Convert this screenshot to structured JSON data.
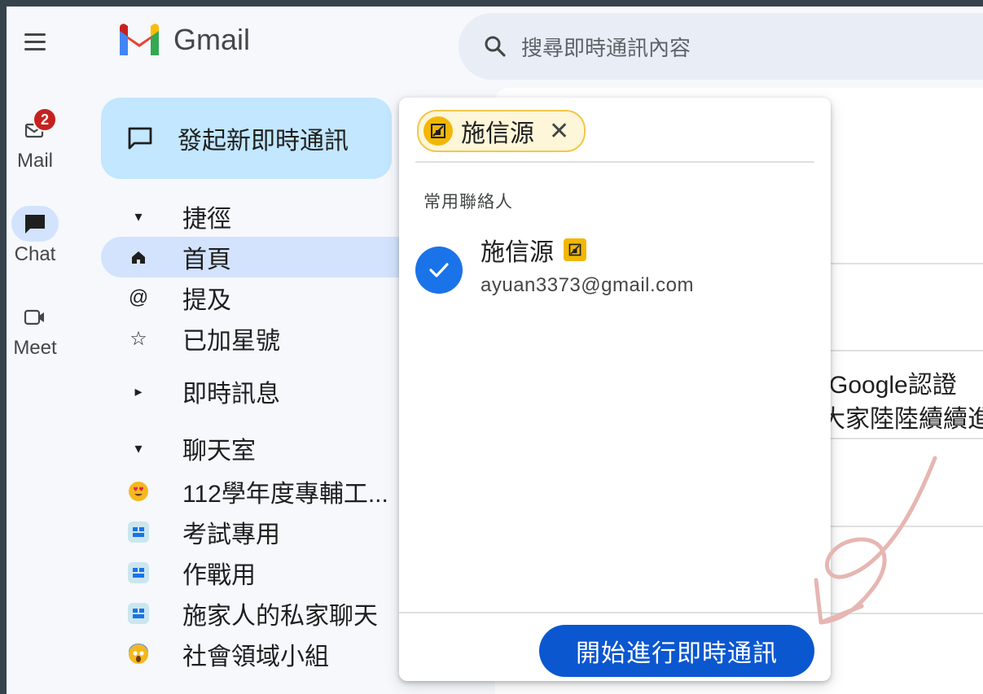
{
  "window": {
    "app_name": "Gmail"
  },
  "search": {
    "placeholder": "搜尋即時通訊內容"
  },
  "rail": {
    "items": [
      {
        "label": "Mail",
        "badge": "2",
        "icon": "mail-icon"
      },
      {
        "label": "Chat",
        "icon": "chat-icon"
      },
      {
        "label": "Meet",
        "icon": "video-icon"
      }
    ]
  },
  "compose": {
    "label": "發起新即時通訊"
  },
  "nav": {
    "shortcuts_label": "捷徑",
    "home_label": "首頁",
    "mentions_label": "提及",
    "starred_label": "已加星號",
    "messages_label": "即時訊息",
    "spaces_label": "聊天室",
    "rooms": [
      {
        "label": "112學年度專輔工...",
        "icon": "heart-eyes-emoji-icon"
      },
      {
        "label": "考試專用",
        "icon": "room-grid-icon"
      },
      {
        "label": "作戰用",
        "icon": "room-grid-icon"
      },
      {
        "label": "施家人的私家聊天",
        "icon": "room-grid-icon"
      },
      {
        "label": "社會領域小組",
        "icon": "scream-emoji-icon"
      }
    ]
  },
  "background": {
    "line1": "-Google認證",
    "line2": "大家陸陸續續進"
  },
  "popup": {
    "selected_chip": "施信源",
    "section_title": "常用聯絡人",
    "contact": {
      "name": "施信源",
      "email": "ayuan3373@gmail.com"
    },
    "start_button": "開始進行即時通訊"
  },
  "colors": {
    "primary": "#0b57d0",
    "selected_nav": "#d3e3fd",
    "compose_bg": "#c2e7ff",
    "chip_border": "#f3c74c",
    "badge": "#c5221f",
    "annotation": "#e6b6b2"
  }
}
